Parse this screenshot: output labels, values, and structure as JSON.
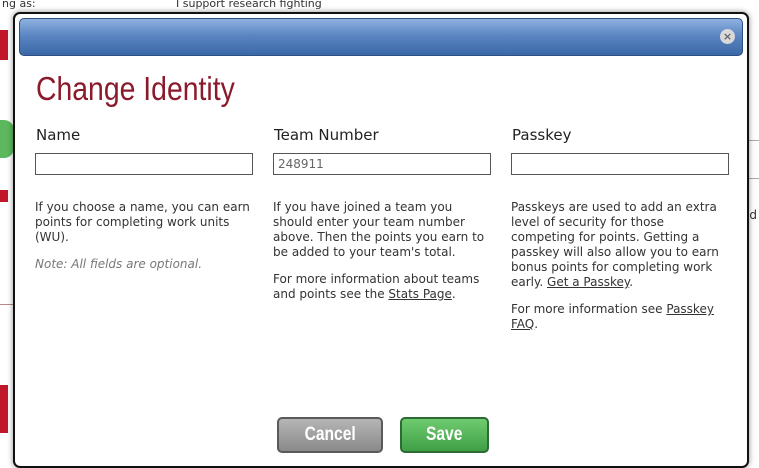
{
  "background": {
    "top_left_text": "ng as:",
    "top_middle_text": "I support research fighting",
    "right_text": "d",
    "colors": {
      "brand_red": "#c0182a",
      "green": "#5cb85c"
    }
  },
  "modal": {
    "close_icon": "×",
    "title": "Change Identity",
    "colors": {
      "title": "#8b1a2b",
      "titlebar": "#4a78b8",
      "cancel": "#9a9a9a",
      "save": "#4caf50"
    },
    "name": {
      "label": "Name",
      "value": "",
      "help": "If you choose a name, you can earn points for completing work units (WU).",
      "note": "Note: All fields are optional."
    },
    "team": {
      "label": "Team Number",
      "value": "248911",
      "help": "If you have joined a team you should enter your team number above. Then the points you earn to be added to your team's total.",
      "info_prefix": "For more information about teams and points see the ",
      "info_link": "Stats Page",
      "info_suffix": "."
    },
    "passkey": {
      "label": "Passkey",
      "value": "",
      "help": "Passkeys are used to add an extra level of security for those competing for points. Getting a passkey will also allow you to earn bonus points for completing work early. ",
      "help_link": "Get a Passkey",
      "help_suffix": ".",
      "info_prefix": "For more information see ",
      "info_link": "Passkey FAQ",
      "info_suffix": "."
    },
    "buttons": {
      "cancel": "Cancel",
      "save": "Save"
    }
  }
}
